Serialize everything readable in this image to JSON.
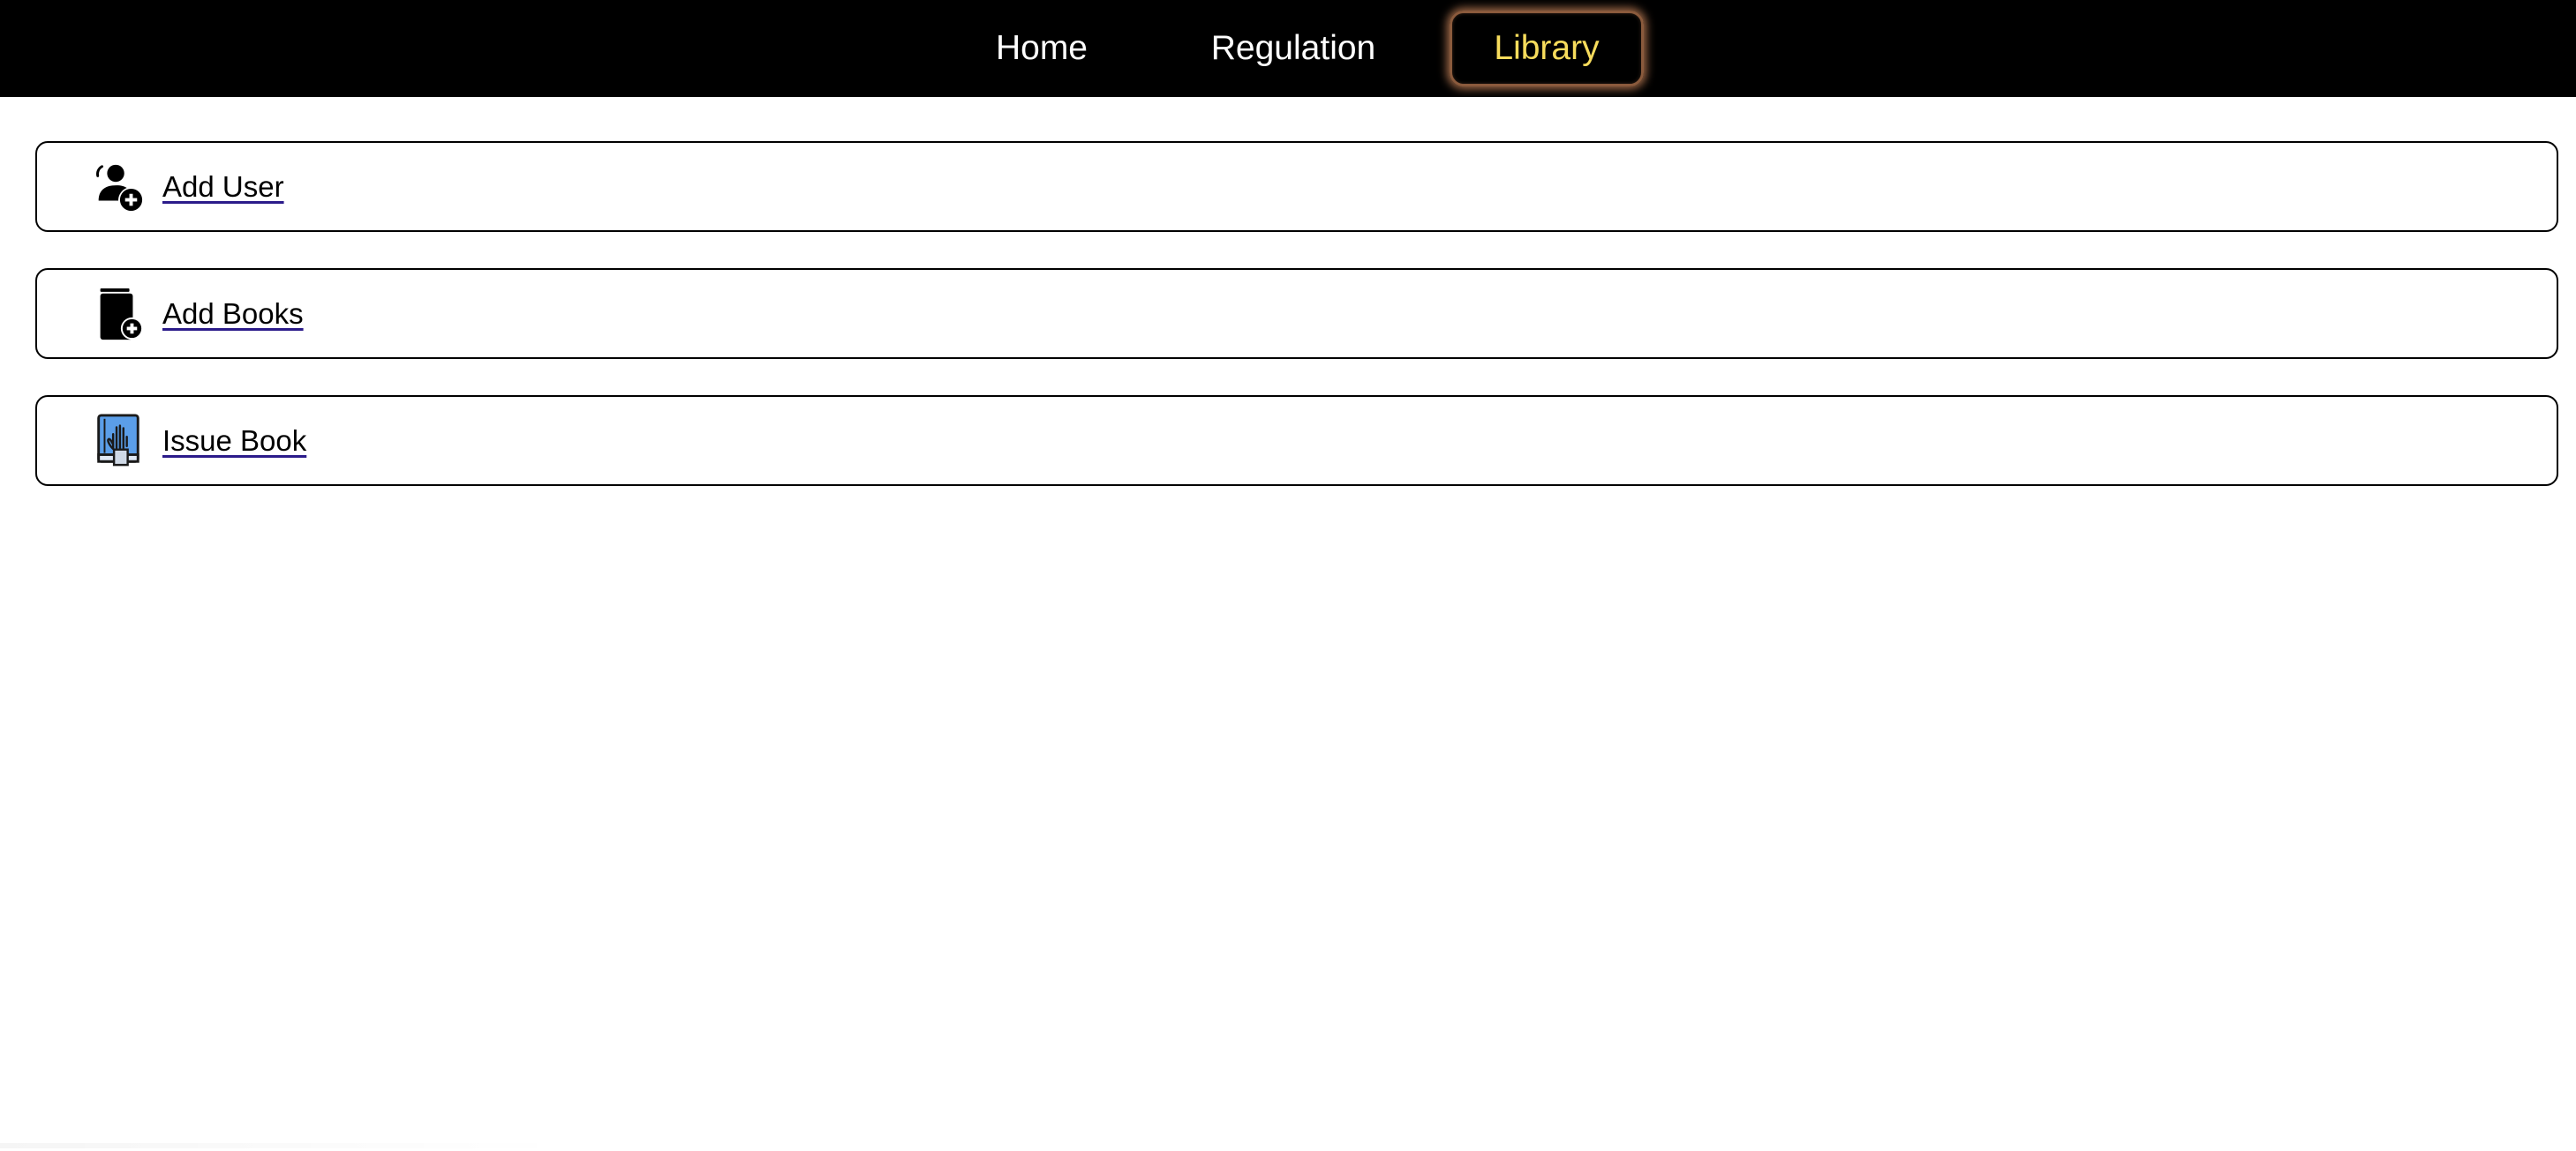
{
  "nav": {
    "items": [
      {
        "label": "Home",
        "active": false
      },
      {
        "label": "Regulation",
        "active": false
      },
      {
        "label": "Library",
        "active": true
      }
    ],
    "active_color": "#f7dc5c",
    "active_glow_color": "#d68e60",
    "background": "#000000"
  },
  "cards": [
    {
      "label": "Add User",
      "icon": "add-user-icon"
    },
    {
      "label": "Add Books",
      "icon": "add-book-icon"
    },
    {
      "label": "Issue Book",
      "icon": "issue-book-icon"
    }
  ],
  "colors": {
    "link_underline": "#2b1b8a",
    "issue_icon_blue": "#5b9ee8"
  }
}
